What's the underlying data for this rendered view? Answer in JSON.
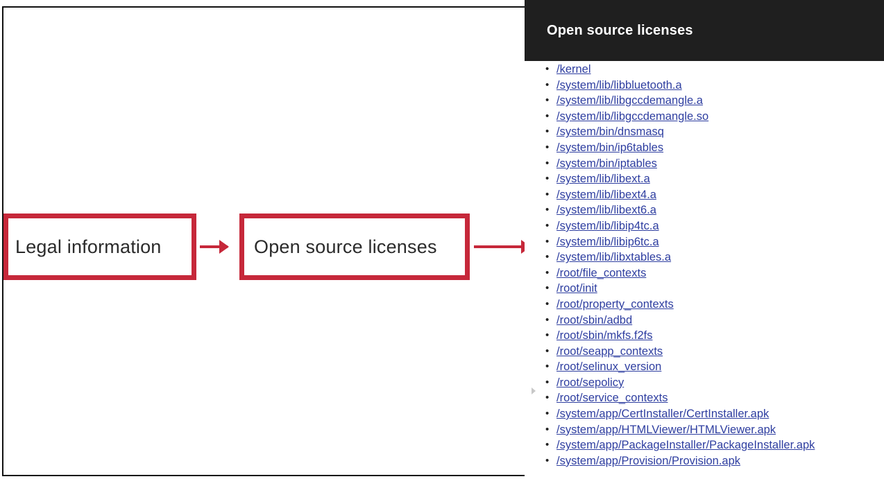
{
  "colors": {
    "accent_red": "#c6283a",
    "header_bg": "#1f1f1f",
    "link": "#2e3ea0"
  },
  "steps": {
    "legal_label": "Legal information",
    "oss_label": "Open source licenses"
  },
  "panel": {
    "title": "Open source licenses",
    "items": [
      "/kernel",
      "/system/lib/libbluetooth.a",
      "/system/lib/libgccdemangle.a",
      "/system/lib/libgccdemangle.so",
      "/system/bin/dnsmasq",
      "/system/bin/ip6tables",
      "/system/bin/iptables",
      "/system/lib/libext.a",
      "/system/lib/libext4.a",
      "/system/lib/libext6.a",
      "/system/lib/libip4tc.a",
      "/system/lib/libip6tc.a",
      "/system/lib/libxtables.a",
      "/root/file_contexts",
      "/root/init",
      "/root/property_contexts",
      "/root/sbin/adbd",
      "/root/sbin/mkfs.f2fs",
      "/root/seapp_contexts",
      "/root/selinux_version",
      "/root/sepolicy",
      "/root/service_contexts",
      "/system/app/CertInstaller/CertInstaller.apk",
      "/system/app/HTMLViewer/HTMLViewer.apk",
      "/system/app/PackageInstaller/PackageInstaller.apk",
      "/system/app/Provision/Provision.apk"
    ]
  }
}
